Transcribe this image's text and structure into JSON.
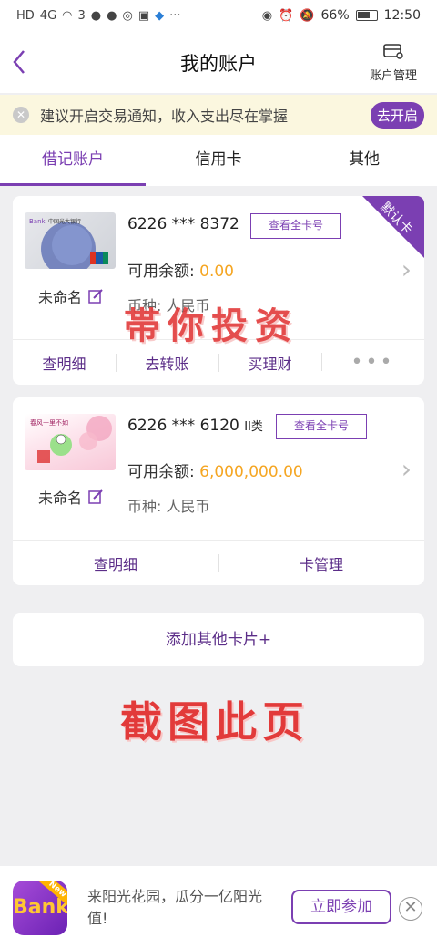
{
  "status_bar": {
    "network": "4G",
    "signal_suffix": "3",
    "battery": "66%",
    "time": "12:50"
  },
  "header": {
    "title": "我的账户",
    "account_mgmt_label": "账户管理"
  },
  "notice": {
    "text": "建议开启交易通知，收入支出尽在掌握",
    "button": "去开启"
  },
  "tabs": [
    {
      "label": "借记账户",
      "active": true
    },
    {
      "label": "信用卡",
      "active": false
    },
    {
      "label": "其他",
      "active": false
    }
  ],
  "cards": [
    {
      "number": "6226 *** 8372",
      "type_suffix": "",
      "view_all": "查看全卡号",
      "balance_label": "可用余额: ",
      "balance": "0.00",
      "name": "未命名",
      "currency": "币种: 人民币",
      "ribbon": "默认卡",
      "actions": [
        "查明细",
        "去转账",
        "买理财"
      ]
    },
    {
      "number": "6226 *** 6120",
      "type_suffix": "II类",
      "view_all": "查看全卡号",
      "balance_label": "可用余额: ",
      "balance": "6,000,000.00",
      "name": "未命名",
      "currency": "币种: 人民币",
      "actions": [
        "查明细",
        "卡管理"
      ]
    }
  ],
  "add_card": "添加其他卡片+",
  "watermarks": {
    "top": "帯你投资",
    "bottom": "截图此页"
  },
  "banner": {
    "logo_text": "Bank",
    "logo_tag": "New",
    "text": "来阳光花园，瓜分一亿阳光值!",
    "button": "立即参加"
  },
  "colors": {
    "brand": "#7b3fb2",
    "amount": "#f5a623",
    "notice_bg": "#fbf7df",
    "watermark": "#e23a3a"
  }
}
